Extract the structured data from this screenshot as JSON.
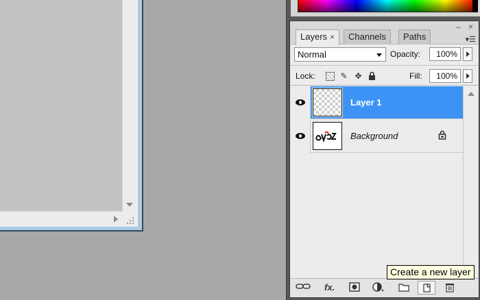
{
  "layers_panel": {
    "tabs": [
      {
        "label": "Layers",
        "close": "×"
      },
      {
        "label": "Channels"
      },
      {
        "label": "Paths"
      }
    ],
    "blend_mode": "Normal",
    "opacity_label": "Opacity:",
    "opacity_value": "100%",
    "lock_label": "Lock:",
    "fill_label": "Fill:",
    "fill_value": "100%",
    "layers": [
      {
        "name": "Layer 1",
        "selected": true
      },
      {
        "name": "Background",
        "selected": false,
        "locked": true
      }
    ],
    "window_controls": {
      "collapse": "–",
      "close": "×"
    }
  },
  "icons": [
    "link-layers-icon",
    "fx-icon",
    "layer-mask-icon",
    "adjustment-layer-icon",
    "new-group-icon",
    "new-layer-icon",
    "trash-icon",
    "eye-icon",
    "lock-icon"
  ],
  "tooltip": {
    "text": "Create a new layer"
  },
  "colors": {
    "selection": "#3d93f5",
    "panel_bg": "#ececec",
    "workspace": "#a8a8a8"
  }
}
